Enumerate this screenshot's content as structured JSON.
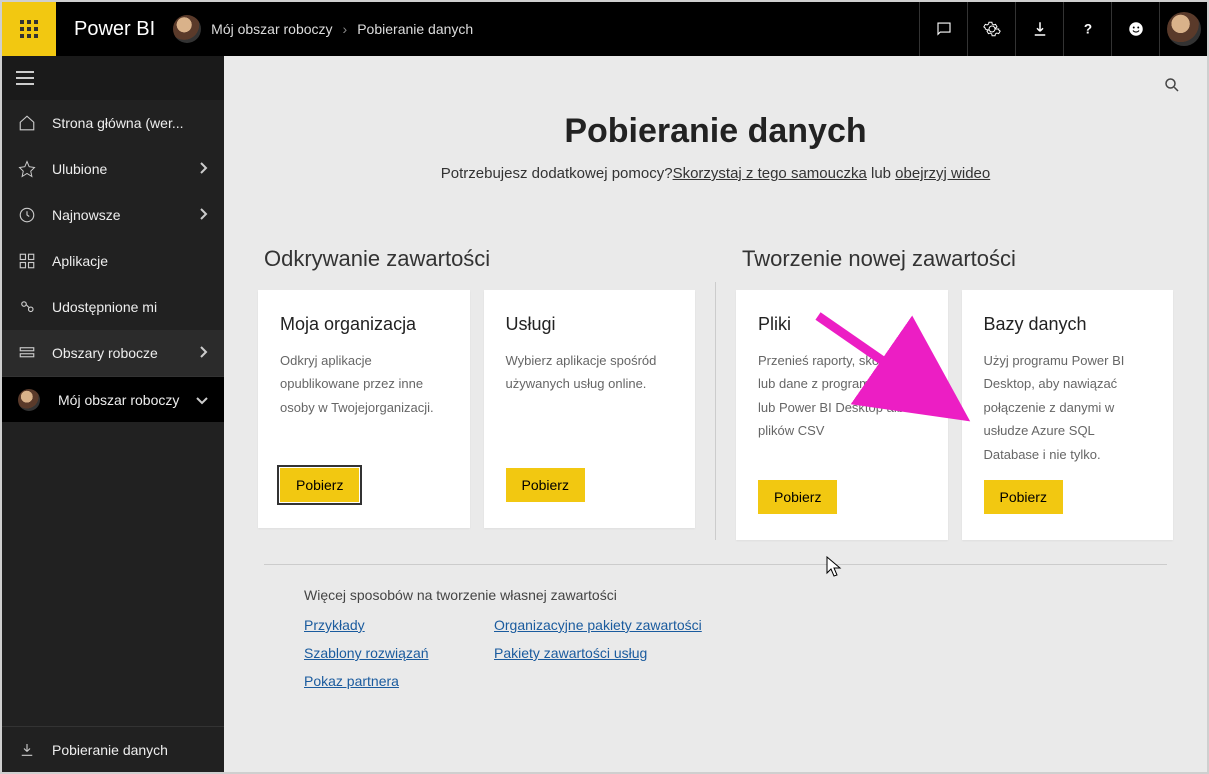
{
  "header": {
    "brand": "Power BI",
    "breadcrumb_workspace": "Mój obszar roboczy",
    "breadcrumb_page": "Pobieranie danych"
  },
  "sidebar": {
    "items": [
      {
        "label": "Strona główna (wer...",
        "icon": "home",
        "chev": false
      },
      {
        "label": "Ulubione",
        "icon": "star",
        "chev": true
      },
      {
        "label": "Najnowsze",
        "icon": "clock",
        "chev": true
      },
      {
        "label": "Aplikacje",
        "icon": "apps",
        "chev": false
      },
      {
        "label": "Udostępnione mi",
        "icon": "share",
        "chev": false
      },
      {
        "label": "Obszary robocze",
        "icon": "workspaces",
        "chev": true
      }
    ],
    "workspace_label": "Mój obszar roboczy",
    "bottom_label": "Pobieranie danych"
  },
  "main": {
    "title": "Pobieranie danych",
    "subtitle_prefix": "Potrzebujesz dodatkowej pomocy?",
    "subtitle_link1": "Skorzystaj z tego samouczka",
    "subtitle_mid": " lub ",
    "subtitle_link2": "obejrzyj wideo",
    "col1_title": "Odkrywanie zawartości",
    "col2_title": "Tworzenie nowej zawartości",
    "cards_discover": [
      {
        "title": "Moja organizacja",
        "desc": "Odkryj aplikacje opublikowane przez inne osoby w Twojejorganizacji.",
        "btn": "Pobierz"
      },
      {
        "title": "Usługi",
        "desc": "Wybierz aplikacje spośród używanych usług online.",
        "btn": "Pobierz"
      }
    ],
    "cards_create": [
      {
        "title": "Pliki",
        "desc": "Przenieś raporty, skoroszyty lub dane z programu Excel lub Power BI Desktop albo z plików CSV",
        "btn": "Pobierz"
      },
      {
        "title": "Bazy danych",
        "desc": "Użyj programu Power BI Desktop, aby nawiązać połączenie z danymi w usłudze Azure SQL Database i nie tylko.",
        "btn": "Pobierz"
      }
    ],
    "more_title": "Więcej sposobów na tworzenie własnej zawartości",
    "more_links_col1": [
      "Przykłady",
      "Szablony rozwiązań",
      "Pokaz partnera"
    ],
    "more_links_col2": [
      "Organizacyjne pakiety zawartości",
      "Pakiety zawartości usług"
    ]
  }
}
